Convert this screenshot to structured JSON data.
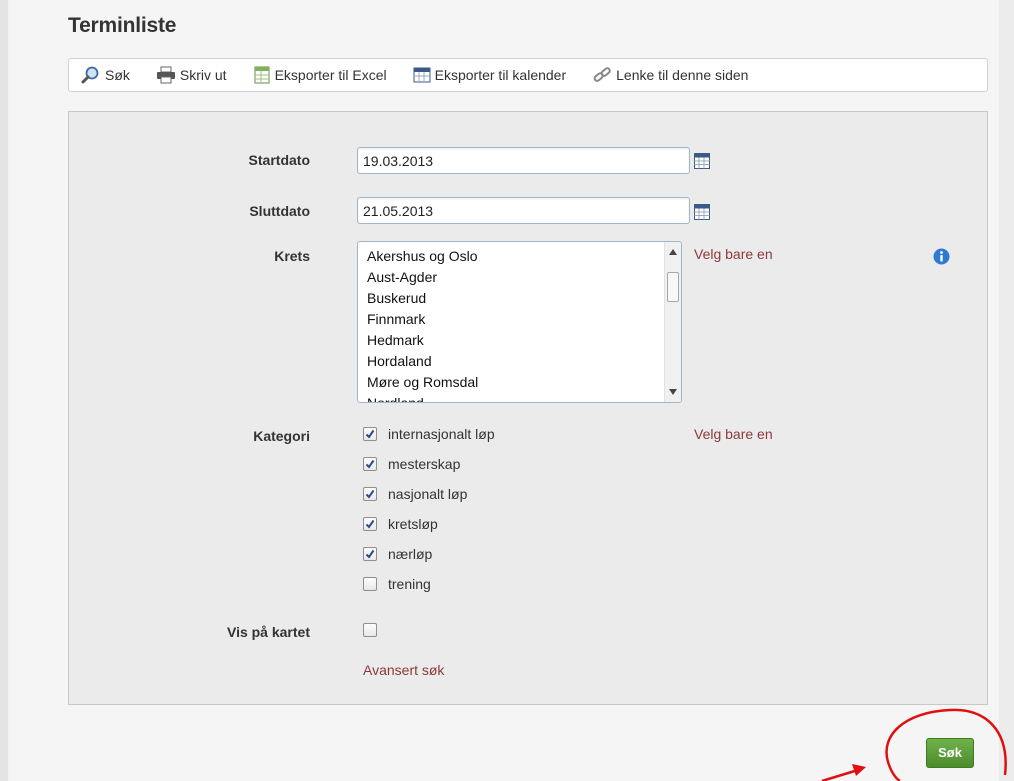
{
  "page": {
    "title": "Terminliste"
  },
  "toolbar": {
    "search": "Søk",
    "print": "Skriv ut",
    "excel": "Eksporter til Excel",
    "calendar": "Eksporter til kalender",
    "link": "Lenke til denne siden"
  },
  "form": {
    "startdato": {
      "label": "Startdato",
      "value": "19.03.2013"
    },
    "sluttdato": {
      "label": "Sluttdato",
      "value": "21.05.2013"
    },
    "krets": {
      "label": "Krets",
      "hint": "Velg bare en",
      "options": [
        "Akershus og Oslo",
        "Aust-Agder",
        "Buskerud",
        "Finnmark",
        "Hedmark",
        "Hordaland",
        "Møre og Romsdal",
        "Nordland"
      ]
    },
    "kategori": {
      "label": "Kategori",
      "hint": "Velg bare en",
      "options": [
        {
          "label": "internasjonalt løp",
          "checked": true
        },
        {
          "label": "mesterskap",
          "checked": true
        },
        {
          "label": "nasjonalt løp",
          "checked": true
        },
        {
          "label": "kretsløp",
          "checked": true
        },
        {
          "label": "nærløp",
          "checked": true
        },
        {
          "label": "trening",
          "checked": false
        }
      ]
    },
    "vis_pa_kartet": {
      "label": "Vis på kartet",
      "checked": false
    },
    "advanced_link": "Avansert søk"
  },
  "actions": {
    "search_button": "Søk"
  },
  "colors": {
    "accent_green": "#4c8c2c",
    "link_brown": "#8b3a3a",
    "annotation_red": "#e01010"
  }
}
